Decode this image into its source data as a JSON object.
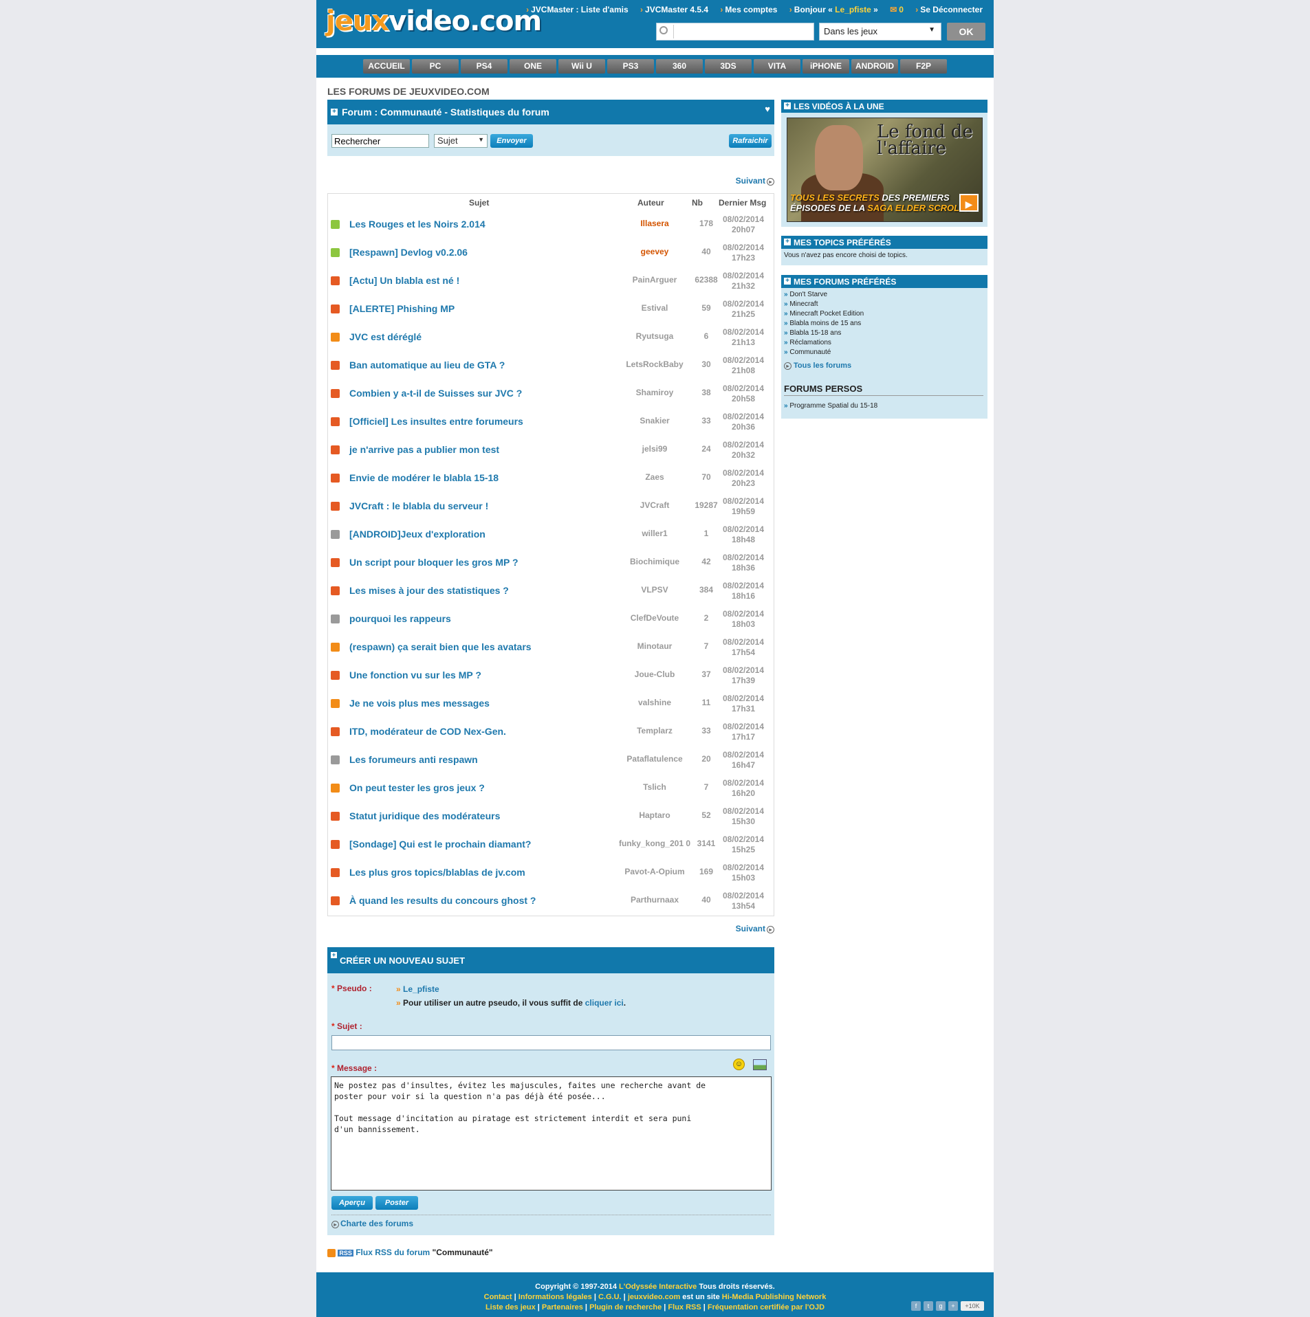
{
  "header": {
    "logo_left": "jeux",
    "logo_right": "video.com",
    "links": [
      "JVCMaster : Liste d'amis",
      "JVCMaster 4.5.4",
      "Mes comptes"
    ],
    "greeting_prefix": "Bonjour «",
    "username": "Le_pfiste",
    "greeting_suffix": "»",
    "mail_count": "0",
    "logout": "Se Déconnecter",
    "search_placeholder": "",
    "scope_value": "Dans les jeux",
    "ok_label": "OK"
  },
  "nav": {
    "tabs": [
      "ACCUEIL",
      "PC",
      "PS4",
      "ONE",
      "Wii U",
      "PS3",
      "360",
      "3DS",
      "VITA",
      "iPHONE",
      "ANDROID",
      "F2P"
    ]
  },
  "main": {
    "section_title": "LES FORUMS DE JEUXVIDEO.COM",
    "forum_title": "Forum : Communauté - Statistiques du forum",
    "search": {
      "value": "Rechercher",
      "type_value": "Sujet",
      "send_label": "Envoyer",
      "refresh_label": "Rafraichir"
    },
    "next_label": "Suivant",
    "columns": {
      "subject": "Sujet",
      "author": "Auteur",
      "count": "Nb",
      "last": "Dernier Msg"
    },
    "topics": [
      {
        "subject": "Les Rouges et les Noirs 2.014",
        "author": "Illasera",
        "nb": "178",
        "date": "08/02/2014",
        "time": "20h07",
        "icon": "green"
      },
      {
        "subject": "[Respawn] Devlog v0.2.06",
        "author": "geevey",
        "nb": "40",
        "date": "08/02/2014",
        "time": "17h23",
        "icon": "green"
      },
      {
        "subject": "[Actu] Un blabla est né !",
        "author": "PainArguer",
        "nb": "62388",
        "date": "08/02/2014",
        "time": "21h32",
        "icon": "red"
      },
      {
        "subject": "[ALERTE] Phishing MP",
        "author": "Estival",
        "nb": "59",
        "date": "08/02/2014",
        "time": "21h25",
        "icon": "red"
      },
      {
        "subject": "JVC est déréglé",
        "author": "Ryutsuga",
        "nb": "6",
        "date": "08/02/2014",
        "time": "21h13",
        "icon": "orange"
      },
      {
        "subject": "Ban automatique au lieu de GTA ?",
        "author": "LetsRockBaby",
        "nb": "30",
        "date": "08/02/2014",
        "time": "21h08",
        "icon": "red"
      },
      {
        "subject": "Combien y a-t-il de Suisses sur JVC ?",
        "author": "Shamiroy",
        "nb": "38",
        "date": "08/02/2014",
        "time": "20h58",
        "icon": "red"
      },
      {
        "subject": "[Officiel] Les insultes entre forumeurs",
        "author": "Snakier",
        "nb": "33",
        "date": "08/02/2014",
        "time": "20h36",
        "icon": "red"
      },
      {
        "subject": "je n'arrive pas a publier mon test",
        "author": "jelsi99",
        "nb": "24",
        "date": "08/02/2014",
        "time": "20h32",
        "icon": "red"
      },
      {
        "subject": "Envie de modérer le blabla 15-18",
        "author": "Zaes",
        "nb": "70",
        "date": "08/02/2014",
        "time": "20h23",
        "icon": "red"
      },
      {
        "subject": "JVCraft : le blabla du serveur !",
        "author": "JVCraft",
        "nb": "19287",
        "date": "08/02/2014",
        "time": "19h59",
        "icon": "red"
      },
      {
        "subject": "[ANDROID]Jeux d'exploration",
        "author": "willer1",
        "nb": "1",
        "date": "08/02/2014",
        "time": "18h48",
        "icon": "grey"
      },
      {
        "subject": "Un script pour bloquer les gros MP ?",
        "author": "Biochimique",
        "nb": "42",
        "date": "08/02/2014",
        "time": "18h36",
        "icon": "red"
      },
      {
        "subject": "Les mises à jour des statistiques ?",
        "author": "VLPSV",
        "nb": "384",
        "date": "08/02/2014",
        "time": "18h16",
        "icon": "red"
      },
      {
        "subject": "pourquoi les rappeurs",
        "author": "ClefDeVoute",
        "nb": "2",
        "date": "08/02/2014",
        "time": "18h03",
        "icon": "grey"
      },
      {
        "subject": "(respawn) ça serait bien que les avatars",
        "author": "Minotaur",
        "nb": "7",
        "date": "08/02/2014",
        "time": "17h54",
        "icon": "orange"
      },
      {
        "subject": "Une fonction vu sur les MP ?",
        "author": "Joue-Club",
        "nb": "37",
        "date": "08/02/2014",
        "time": "17h39",
        "icon": "red"
      },
      {
        "subject": "Je ne vois plus mes messages",
        "author": "valshine",
        "nb": "11",
        "date": "08/02/2014",
        "time": "17h31",
        "icon": "orange"
      },
      {
        "subject": "ITD, modérateur de COD Nex-Gen.",
        "author": "Templarz",
        "nb": "33",
        "date": "08/02/2014",
        "time": "17h17",
        "icon": "red"
      },
      {
        "subject": "Les forumeurs anti respawn",
        "author": "Pataflatulence",
        "nb": "20",
        "date": "08/02/2014",
        "time": "16h47",
        "icon": "grey"
      },
      {
        "subject": "On peut tester les gros jeux ?",
        "author": "Tslich",
        "nb": "7",
        "date": "08/02/2014",
        "time": "16h20",
        "icon": "orange"
      },
      {
        "subject": "Statut juridique des modérateurs",
        "author": "Haptaro",
        "nb": "52",
        "date": "08/02/2014",
        "time": "15h30",
        "icon": "red"
      },
      {
        "subject": "[Sondage] Qui est le prochain diamant?",
        "author": "funky_kong_201 0",
        "nb": "3141",
        "date": "08/02/2014",
        "time": "15h25",
        "icon": "red"
      },
      {
        "subject": "Les plus gros topics/blablas de jv.com",
        "author": "Pavot-A-Opium",
        "nb": "169",
        "date": "08/02/2014",
        "time": "15h03",
        "icon": "red"
      },
      {
        "subject": "À quand les results du concours ghost ?",
        "author": "Parthurnaax",
        "nb": "40",
        "date": "08/02/2014",
        "time": "13h54",
        "icon": "red"
      }
    ],
    "new_topic": {
      "title": "CRÉER UN NOUVEAU SUJET",
      "pseudo_label": "Pseudo :",
      "pseudo_value": "Le_pfiste",
      "pseudo_hint": "Pour utiliser un autre pseudo, il vous suffit de",
      "pseudo_link": "cliquer ici",
      "subject_label": "Sujet :",
      "message_label": "Message :",
      "message_text": "Ne postez pas d'insultes, évitez les majuscules, faites une recherche avant de\nposter pour voir si la question n'a pas déjà été posée...\n\nTout message d'incitation au piratage est strictement interdit et sera puni\nd'un bannissement.",
      "preview_label": "Aperçu",
      "post_label": "Poster",
      "charter_label": "Charte des forums"
    },
    "rss": {
      "badge": "RSS",
      "text": "Flux RSS du forum",
      "forum_name": "\"Communauté\""
    }
  },
  "sidebar": {
    "videos_title": "LES VIDÉOS À LA UNE",
    "video_title": "Le fond de l'affaire",
    "video_caption_1a": "TOUS LES SECRETS",
    "video_caption_1b": "DES PREMIERS",
    "video_caption_2a": "ÉPISODES DE LA",
    "video_caption_2b": "SAGA ELDER SCROLLS",
    "topics_title": "MES TOPICS PRÉFÉRÉS",
    "topics_empty": "Vous n'avez pas encore choisi de topics.",
    "forums_title": "MES FORUMS PRÉFÉRÉS",
    "forums": [
      "Don't Starve",
      "Minecraft",
      "Minecraft Pocket Edition",
      "Blabla moins de 15 ans",
      "Blabla 15-18 ans",
      "Réclamations",
      "Communauté"
    ],
    "all_forums": "Tous les forums",
    "persos_title": "FORUMS PERSOS",
    "persos": [
      "Programme Spatial du 15-18"
    ]
  },
  "footer": {
    "copyright": "Copyright © 1997-2014",
    "company": "L'Odyssée Interactive",
    "rights": "Tous droits réservés.",
    "line2": [
      "Contact",
      "Informations légales",
      "C.G.U.",
      "jeuxvideo.com"
    ],
    "line2_mid": "est un site",
    "line2_end": "Hi-Media Publishing Network",
    "line3": [
      "Liste des jeux",
      "Partenaires",
      "Plugin de recherche",
      "Flux RSS",
      "Fréquentation certifiée par l'OJD"
    ],
    "social_count": "+10K"
  },
  "colors": {
    "brand_blue": "#1178ab",
    "panel_blue": "#d1e8f2",
    "link_blue": "#1f79ad",
    "accent_orange": "#f28c18"
  }
}
